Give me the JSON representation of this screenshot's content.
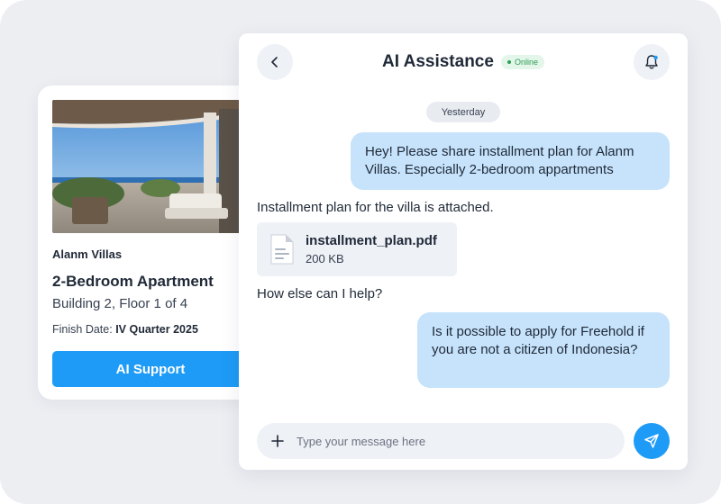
{
  "property_card": {
    "photo_alt": "Apartment terrace with sea view",
    "villa_name": "Alanm Villas",
    "apartment_title": "2-Bedroom Apartment",
    "building_info": "Building 2, Floor 1 of 4",
    "finish_label": "Finish Date:",
    "finish_value": "IV Quarter 2025",
    "support_button": "AI Support"
  },
  "chat": {
    "title": "AI Assistance",
    "status": "Online",
    "day_divider": "Yesterday",
    "messages": [
      {
        "from": "user",
        "text": "Hey! Please share installment plan for Alanm Villas. Especially 2-bedroom appartments"
      },
      {
        "from": "assistant",
        "text": "Installment plan for the villa is attached."
      },
      {
        "from": "assistant",
        "attachment": {
          "name": "installment_plan.pdf",
          "size": "200 KB"
        }
      },
      {
        "from": "assistant",
        "text": "How else can I help?"
      },
      {
        "from": "user",
        "text": "Is it possible to apply for Freehold if you are not a citizen of Indonesia?"
      }
    ],
    "composer_placeholder": "Type your message here"
  },
  "icons": {
    "back": "chevron-left-icon",
    "bell": "bell-icon",
    "file": "document-icon",
    "plus": "plus-icon",
    "send": "send-icon"
  },
  "colors": {
    "accent": "#1e9bf6",
    "bubble_out": "#c6e3fb",
    "online": "#2e9d57",
    "panel_bg": "#eceef2"
  }
}
